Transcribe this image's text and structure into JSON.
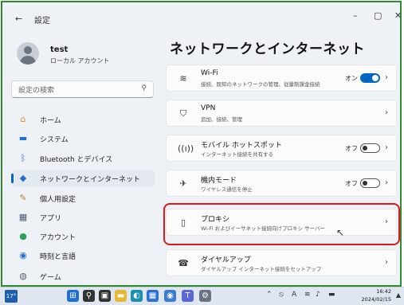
{
  "window": {
    "title": "設定",
    "back": "←",
    "minimize": "–",
    "maximize": "▢",
    "close": "✕"
  },
  "profile": {
    "name": "test",
    "account_type": "ローカル アカウント"
  },
  "search": {
    "placeholder": "設定の検索",
    "icon": "search-icon"
  },
  "sidebar": {
    "items": [
      {
        "label": "ホーム",
        "icon": "home-icon",
        "glyph": "⌂",
        "color": "#e08a2c"
      },
      {
        "label": "システム",
        "icon": "display-icon",
        "glyph": "▬",
        "color": "#1f6fcf"
      },
      {
        "label": "Bluetooth とデバイス",
        "icon": "bluetooth-icon",
        "glyph": "ᛒ",
        "color": "#1f6fcf"
      },
      {
        "label": "ネットワークとインターネット",
        "icon": "wifi-diamond-icon",
        "glyph": "◆",
        "color": "#1f6fcf",
        "active": true
      },
      {
        "label": "個人用設定",
        "icon": "brush-icon",
        "glyph": "✎",
        "color": "#c77a2a"
      },
      {
        "label": "アプリ",
        "icon": "apps-icon",
        "glyph": "▦",
        "color": "#4a5a70"
      },
      {
        "label": "アカウント",
        "icon": "person-icon",
        "glyph": "●",
        "color": "#2aa05a"
      },
      {
        "label": "時刻と言語",
        "icon": "globe-icon",
        "glyph": "◉",
        "color": "#1f6fcf"
      },
      {
        "label": "ゲーム",
        "icon": "gamepad-icon",
        "glyph": "◍",
        "color": "#5a6575"
      }
    ]
  },
  "main": {
    "title": "ネットワークとインターネット",
    "cards": [
      {
        "title": "Wi-Fi",
        "subtitle": "接続、既知のネットワークの管理、従量制課金接続",
        "icon": "wifi-icon",
        "glyph": "≋",
        "toggle_label": "オン",
        "toggle_on": true
      },
      {
        "title": "VPN",
        "subtitle": "追加、接続、管理",
        "icon": "shield-icon",
        "glyph": "⛉"
      },
      {
        "title": "モバイル ホットスポット",
        "subtitle": "インターネット接続を共有する",
        "icon": "hotspot-icon",
        "glyph": "((ı))",
        "toggle_label": "オフ",
        "toggle_on": false
      },
      {
        "title": "機内モード",
        "subtitle": "ワイヤレス通信を停止",
        "icon": "airplane-icon",
        "glyph": "✈",
        "toggle_label": "オフ",
        "toggle_on": false
      },
      {
        "title": "プロキシ",
        "subtitle": "Wi-Fi およびイーサネット接続向けプロキシ サーバー",
        "icon": "proxy-icon",
        "glyph": "▯"
      },
      {
        "title": "ダイヤルアップ",
        "subtitle": "ダイヤルアップ インターネット接続をセットアップ",
        "icon": "dialup-icon",
        "glyph": "☎"
      }
    ],
    "chevron": "›"
  },
  "taskbar": {
    "weather": "17°",
    "apps": [
      {
        "icon": "windows-start-icon",
        "glyph": "⊞",
        "color": "#1f6fcf"
      },
      {
        "icon": "search-icon",
        "glyph": "⚲",
        "color": "#333333"
      },
      {
        "icon": "task-view-icon",
        "glyph": "▣",
        "color": "#333333"
      },
      {
        "icon": "file-explorer-icon",
        "glyph": "▬",
        "color": "#e8b730"
      },
      {
        "icon": "edge-icon",
        "glyph": "◐",
        "color": "#1a8fb0"
      },
      {
        "icon": "store-icon",
        "glyph": "▦",
        "color": "#2a6fd6"
      },
      {
        "icon": "chrome-icon",
        "glyph": "◉",
        "color": "#3a7bd5"
      },
      {
        "icon": "teams-icon",
        "glyph": "T",
        "color": "#5a67d8"
      },
      {
        "icon": "settings-icon",
        "glyph": "⚙",
        "color": "#6b7280"
      }
    ],
    "tray": [
      {
        "icon": "chevron-up-icon",
        "glyph": "⌃"
      },
      {
        "icon": "network-status-icon",
        "glyph": "⦸"
      },
      {
        "icon": "ime-icon",
        "glyph": "A"
      },
      {
        "icon": "wifi-icon",
        "glyph": "≋"
      },
      {
        "icon": "volume-icon",
        "glyph": "♪"
      },
      {
        "icon": "battery-icon",
        "glyph": "▬"
      }
    ],
    "time": "16:42",
    "date": "2024/02/15"
  }
}
